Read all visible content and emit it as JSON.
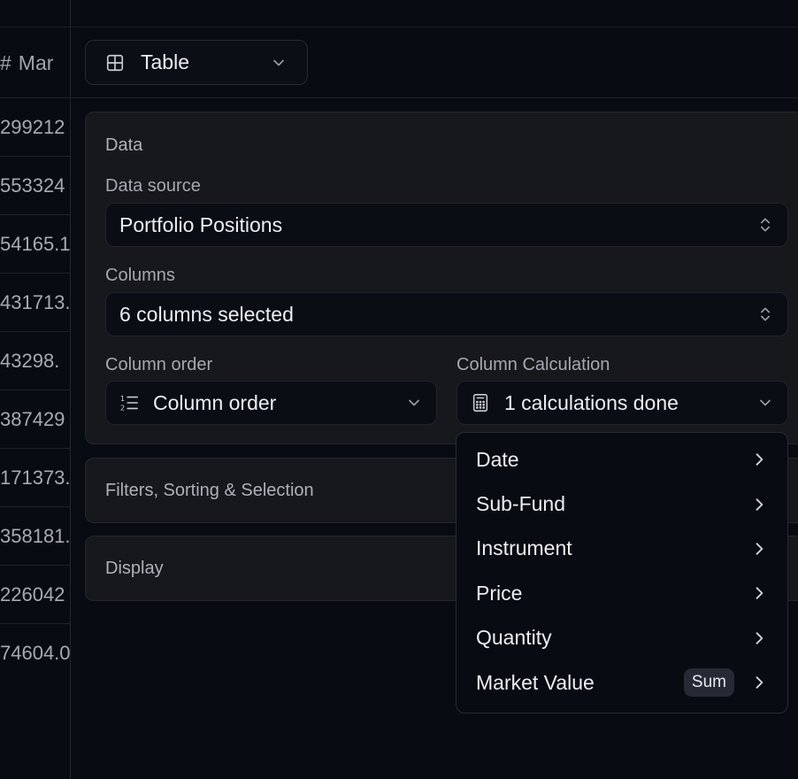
{
  "table_column": {
    "header_icon": "hash-icon",
    "header_label": "Mar",
    "cells": [
      "299212",
      "553324",
      "54165.1",
      "431713.",
      "43298.",
      "387429",
      "171373.",
      "358181.",
      "226042",
      "74604.0"
    ]
  },
  "view_select": {
    "icon": "table-grid-icon",
    "label": "Table"
  },
  "data_section": {
    "title": "Data",
    "data_source": {
      "label": "Data source",
      "value": "Portfolio Positions"
    },
    "columns": {
      "label": "Columns",
      "value": "6 columns selected"
    },
    "column_order": {
      "label": "Column order",
      "value": "Column order",
      "icon": "ordered-list-icon"
    },
    "column_calculation": {
      "label": "Column Calculation",
      "value": "1 calculations done",
      "icon": "calculator-icon"
    }
  },
  "filters_section": {
    "title": "Filters, Sorting & Selection"
  },
  "display_section": {
    "title": "Display"
  },
  "calculation_menu": {
    "items": [
      {
        "label": "Date",
        "badge": ""
      },
      {
        "label": "Sub-Fund",
        "badge": ""
      },
      {
        "label": "Instrument",
        "badge": ""
      },
      {
        "label": "Price",
        "badge": ""
      },
      {
        "label": "Quantity",
        "badge": ""
      },
      {
        "label": "Market Value",
        "badge": "Sum"
      }
    ]
  },
  "colors": {
    "background": "#090b12",
    "panel": "#17181c",
    "field": "#0a0d14",
    "text": "#eceef2",
    "muted_text": "#a4a8b1"
  }
}
